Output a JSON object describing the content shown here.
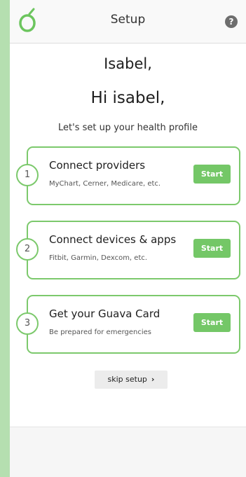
{
  "header": {
    "title": "Setup",
    "help_icon": "?"
  },
  "greeting": {
    "name_line": "Isabel,",
    "hi_line": "Hi isabel,",
    "subtitle": "Let's set up your health profile"
  },
  "steps": [
    {
      "number": "1",
      "title": "Connect providers",
      "description": "MyChart, Cerner, Medicare, etc.",
      "button_label": "Start"
    },
    {
      "number": "2",
      "title": "Connect devices & apps",
      "description": "Fitbit, Garmin, Dexcom, etc.",
      "button_label": "Start"
    },
    {
      "number": "3",
      "title": "Get your Guava Card",
      "description": "Be prepared for emergencies",
      "button_label": "Start"
    }
  ],
  "skip": {
    "label": "skip setup",
    "chevron": "›"
  },
  "colors": {
    "accent_green": "#74c767",
    "border_green": "#7cc96c",
    "side_background": "#b5dfb0"
  },
  "icons": {
    "logo": "guava-logo-icon",
    "help": "question-circle-icon",
    "skip": "chevron-right-icon"
  }
}
